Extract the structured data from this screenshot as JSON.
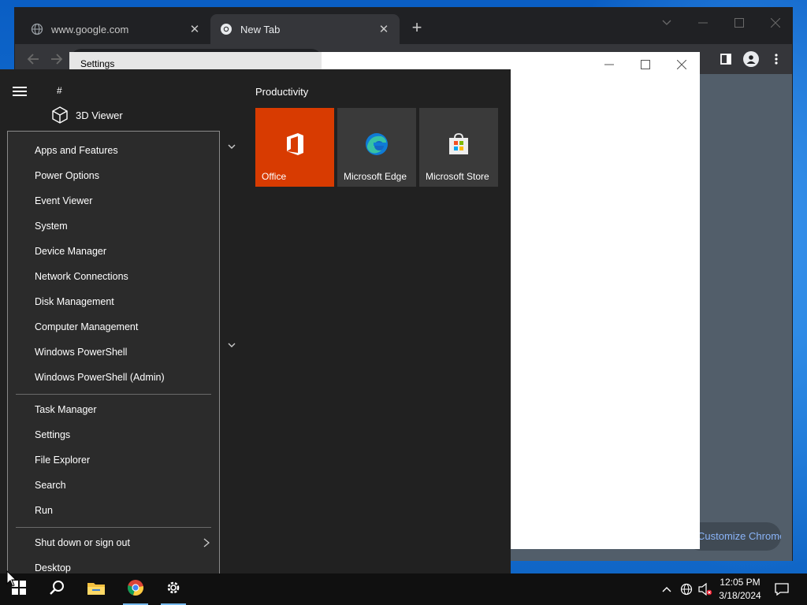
{
  "chrome": {
    "tabs": [
      {
        "title": "www.google.com",
        "favicon": "globe-icon",
        "active": false
      },
      {
        "title": "New Tab",
        "favicon": "chrome-icon",
        "active": true
      }
    ],
    "new_tab_symbol": "+",
    "close_symbol": "✕",
    "customize_label": "Customize Chrome"
  },
  "settings_window": {
    "title": "Settings"
  },
  "start_menu": {
    "letter_heading": "#",
    "apps": [
      {
        "label": "3D Viewer",
        "icon": "cube-icon"
      }
    ],
    "group_title": "Productivity",
    "tiles": [
      {
        "label": "Office",
        "icon": "office-icon",
        "color": "#d83b01"
      },
      {
        "label": "Microsoft Edge",
        "icon": "edge-icon",
        "color": "#3a3a3a"
      },
      {
        "label": "Microsoft Store",
        "icon": "store-icon",
        "color": "#3a3a3a"
      }
    ]
  },
  "winx_menu": {
    "group1": [
      "Apps and Features",
      "Power Options",
      "Event Viewer",
      "System",
      "Device Manager",
      "Network Connections",
      "Disk Management",
      "Computer Management",
      "Windows PowerShell",
      "Windows PowerShell (Admin)"
    ],
    "group2": [
      "Task Manager",
      "Settings",
      "File Explorer",
      "Search",
      "Run"
    ],
    "group3": [
      "Shut down or sign out",
      "Desktop"
    ]
  },
  "taskbar": {
    "time": "12:05 PM",
    "date": "3/18/2024",
    "pinned": [
      "start-icon",
      "search-icon",
      "file-explorer-icon",
      "chrome-icon",
      "settings-icon"
    ]
  },
  "colors": {
    "accent": "#76b9ed",
    "office_tile": "#d83b01",
    "start_bg": "#212121",
    "winx_bg": "#2b2b2b",
    "chrome_link": "#8ab4f8"
  }
}
